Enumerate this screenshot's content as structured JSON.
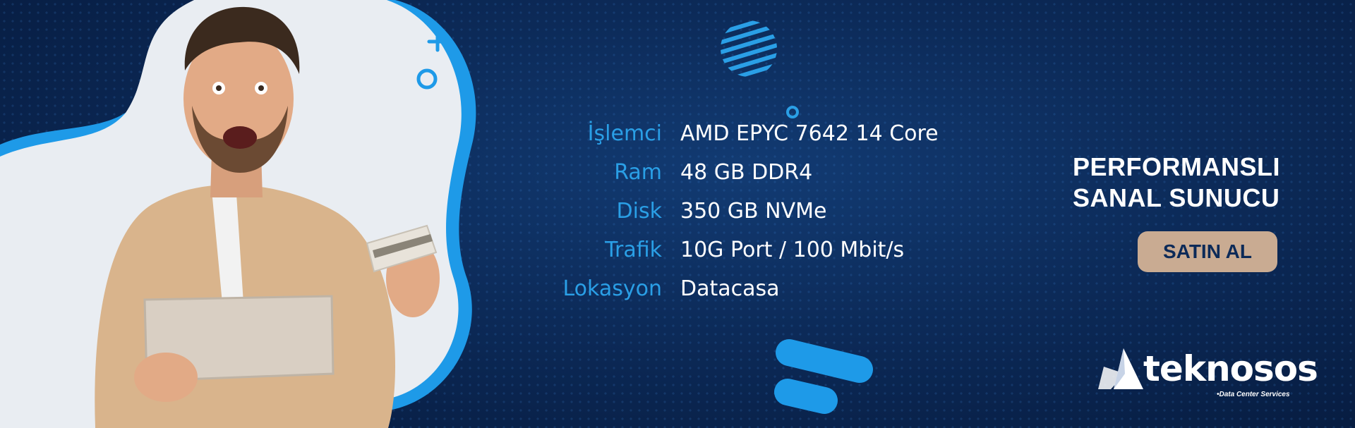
{
  "banner": {
    "specs": [
      {
        "label": "İşlemci",
        "value": "AMD EPYC 7642 14 Core"
      },
      {
        "label": "Ram",
        "value": "48 GB DDR4"
      },
      {
        "label": "Disk",
        "value": "350 GB NVMe"
      },
      {
        "label": "Trafik",
        "value": "10G Port / 100 Mbit/s"
      },
      {
        "label": "Lokasyon",
        "value": "Datacasa"
      }
    ],
    "headline_line1": "PERFORMANSLI",
    "headline_line2": "SANAL SUNUCU",
    "cta_label": "SATIN AL"
  },
  "brand": {
    "name": "teknosos",
    "tagline": "•Data Center Services"
  },
  "colors": {
    "background": "#0c2a58",
    "accent_blue": "#2a9fe6",
    "cta_background": "#c9ab92",
    "text": "#ffffff"
  },
  "icons": [
    "striped-circle-icon",
    "small-ring-icon",
    "plus-icon",
    "ring-icon",
    "brand-stripes-icon",
    "logo-mark-icon"
  ]
}
